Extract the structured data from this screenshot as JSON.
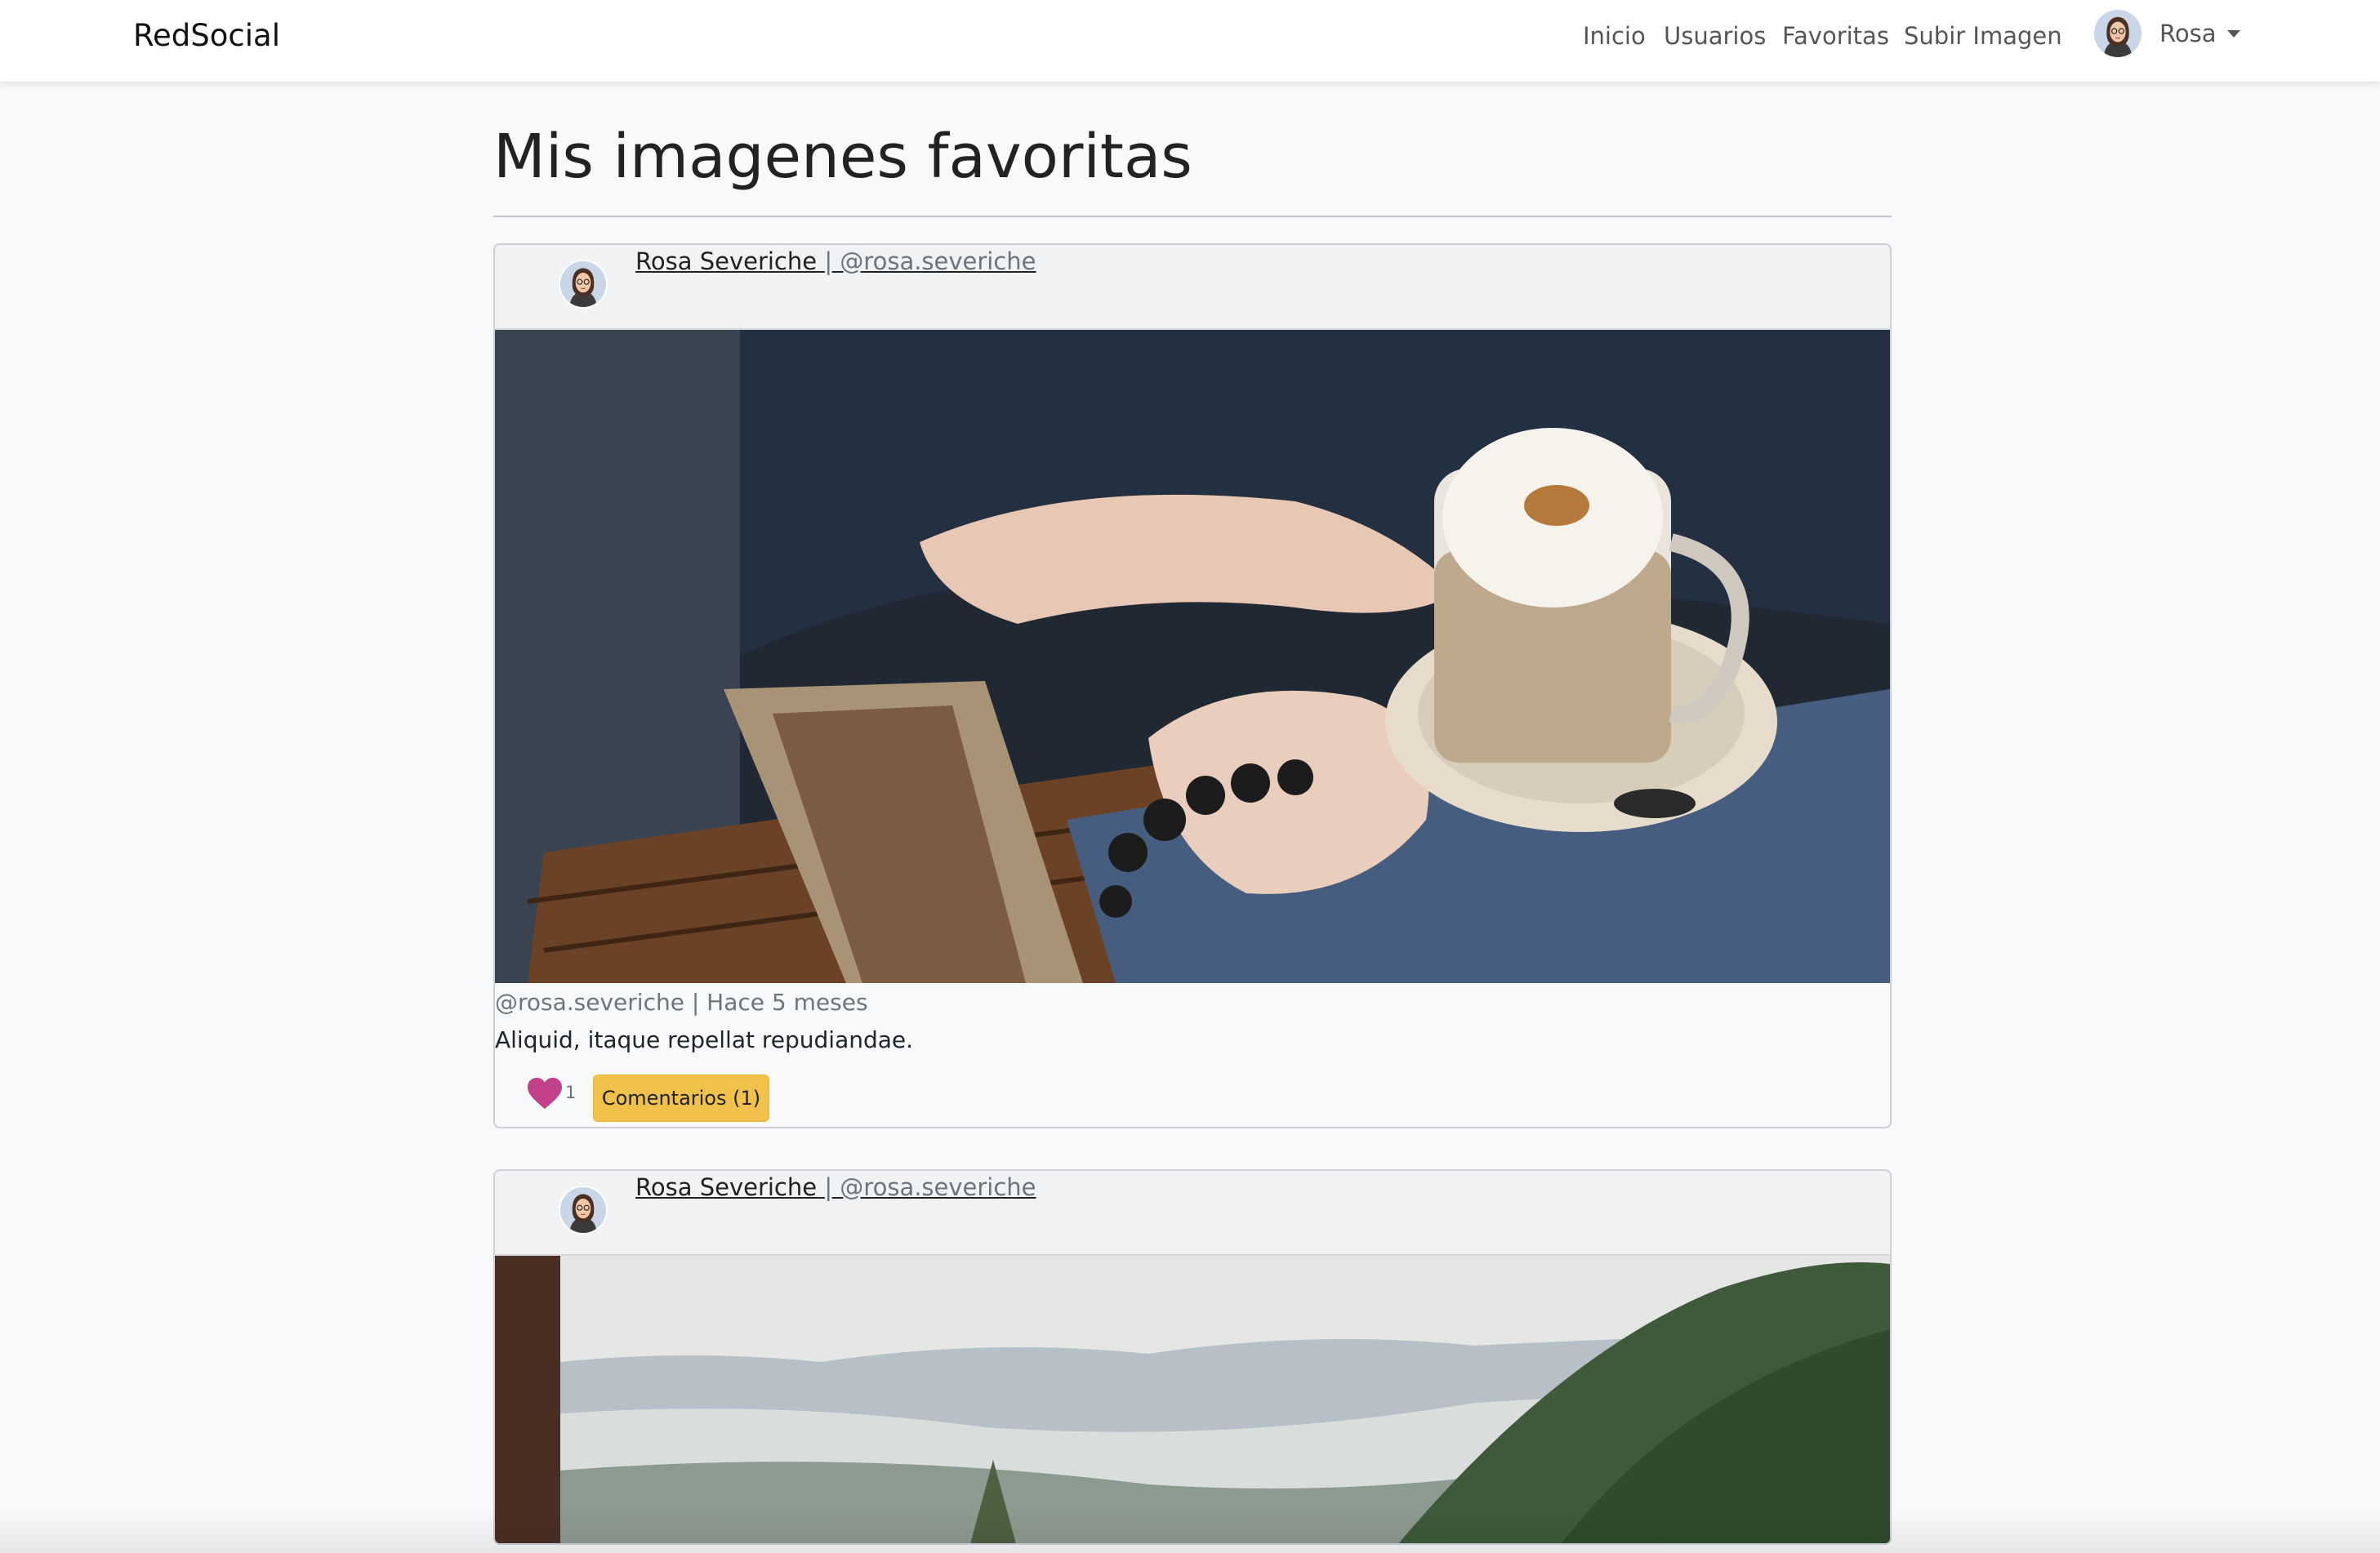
{
  "navbar": {
    "brand": "RedSocial",
    "links": [
      {
        "label": "Inicio"
      },
      {
        "label": "Usuarios"
      },
      {
        "label": "Favoritas"
      },
      {
        "label": "Subir Imagen"
      }
    ],
    "user_name": "Rosa"
  },
  "page": {
    "title": "Mis imagenes favoritas"
  },
  "posts": [
    {
      "author_name": "Rosa Severiche",
      "author_nick": "| @rosa.severiche",
      "meta": "@rosa.severiche | Hace 5 meses",
      "description": "Aliquid, itaque repellat repudiandae.",
      "likes": "1",
      "comments_label": "Comentarios (1)"
    },
    {
      "author_name": "Rosa Severiche",
      "author_nick": "| @rosa.severiche"
    }
  ],
  "colors": {
    "heart": "#c2418a",
    "comments_button": "#f0c14b",
    "navbar_bg": "#ffffff",
    "page_bg": "#f8f9fa"
  }
}
